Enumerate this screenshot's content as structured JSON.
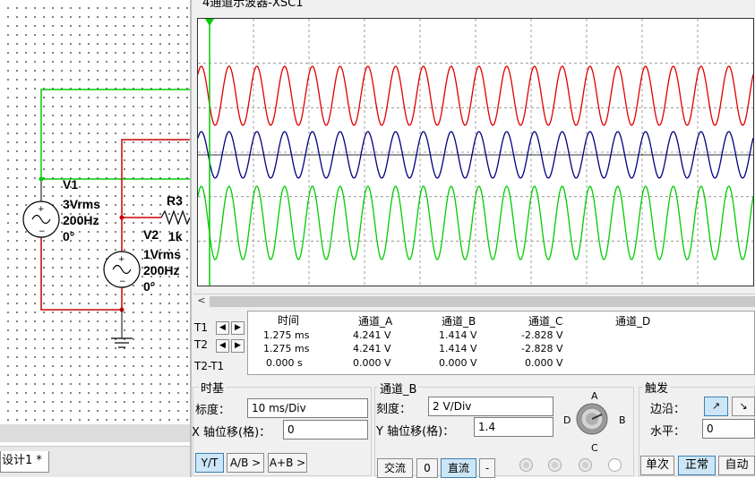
{
  "window_title": "4通道示波器-XSC1",
  "design_tab": "设计1 *",
  "schematic": {
    "v1": {
      "name": "V1",
      "voltage": "3Vrms",
      "freq": "200Hz",
      "phase": "0°"
    },
    "v2": {
      "name": "V2",
      "voltage": "1Vrms",
      "freq": "200Hz",
      "phase": "0°"
    },
    "r3": {
      "name": "R3",
      "value": "1k"
    }
  },
  "readout": {
    "headers": [
      "时间",
      "通道_A",
      "通道_B",
      "通道_C",
      "通道_D"
    ],
    "rows": [
      {
        "label": "T1",
        "time": "1.275 ms",
        "a": "4.241 V",
        "b": "1.414 V",
        "c": "-2.828 V",
        "d": ""
      },
      {
        "label": "T2",
        "time": "1.275 ms",
        "a": "4.241 V",
        "b": "1.414 V",
        "c": "-2.828 V",
        "d": ""
      },
      {
        "label": "T2-T1",
        "time": "0.000 s",
        "a": "0.000 V",
        "b": "0.000 V",
        "c": "0.000 V",
        "d": ""
      }
    ]
  },
  "timebase": {
    "title": "时基",
    "scale_label": "标度：",
    "scale_value": "10 ms/Div",
    "xpos_label": "X 轴位移(格)：",
    "xpos_value": "0",
    "mode_buttons": [
      "Y/T",
      "A/B >",
      "A+B >"
    ]
  },
  "channel": {
    "title": "通道_B",
    "scale_label": "刻度：",
    "scale_value": "2  V/Div",
    "ypos_label": "Y 轴位移(格)：",
    "ypos_value": "1.4",
    "coupling_buttons": [
      "交流",
      "0",
      "直流",
      "-"
    ],
    "knob_labels": {
      "a": "A",
      "b": "B",
      "c": "C",
      "d": "D"
    }
  },
  "trigger": {
    "title": "触发",
    "edge_label": "边沿：",
    "level_label": "水平：",
    "level_value": "0",
    "edge_rise": "↗",
    "edge_fall": "↘",
    "mode_buttons": [
      "单次",
      "正常",
      "自动"
    ]
  },
  "colors": {
    "ch_a": "#e00000",
    "ch_b": "#000080",
    "ch_c": "#00cc00",
    "cursor": "#00cc00"
  }
}
